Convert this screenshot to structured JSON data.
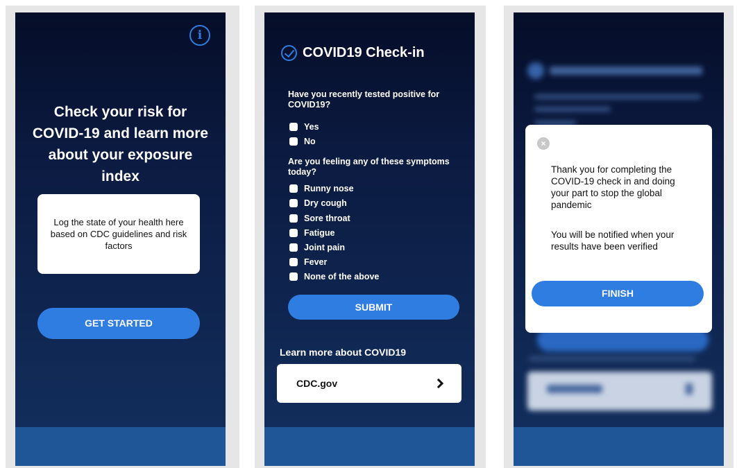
{
  "screen1": {
    "headline": "Check your risk for COVID-19 and learn more about your exposure index",
    "card_text": "Log the state of your health here based on CDC guidelines and risk factors",
    "cta_label": "GET STARTED",
    "info_glyph": "i"
  },
  "screen2": {
    "title": "COVID19 Check-in",
    "q1": "Have you recently tested positive for COVID19?",
    "q1_options": [
      "Yes",
      "No"
    ],
    "q2": "Are you feeling any of these symptoms today?",
    "q2_options": [
      "Runny nose",
      "Dry cough",
      "Sore throat",
      "Fatigue",
      "Joint pain",
      "Fever",
      "None of the above"
    ],
    "submit_label": "SUBMIT",
    "learn_label": "Learn more about COVID19",
    "cdc_label": "CDC.gov"
  },
  "screen3": {
    "close_glyph": "×",
    "message1": "Thank you for completing the COVID-19 check in and doing your part to stop the global pandemic",
    "message2": "You will be notified when your results have been verified",
    "finish_label": "FINISH"
  },
  "colors": {
    "accent": "#2f7de1",
    "footer": "#1f5697",
    "background_top": "#050d28",
    "background_bottom": "#13305f"
  }
}
